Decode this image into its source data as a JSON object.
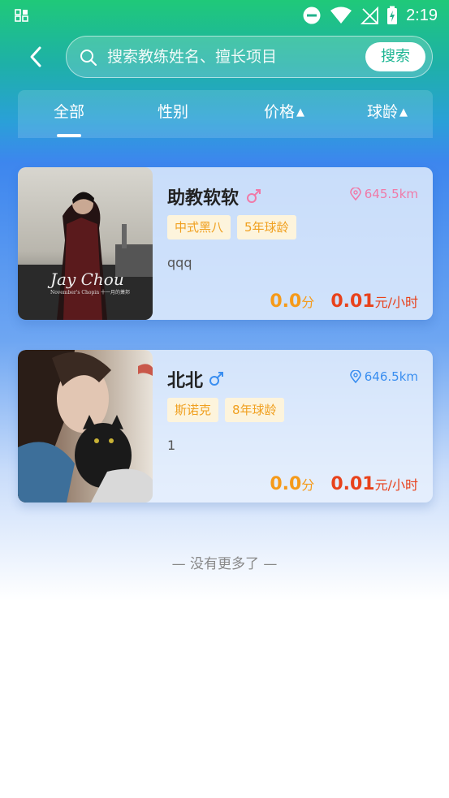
{
  "status_bar": {
    "time": "2:19"
  },
  "search": {
    "placeholder": "搜索教练姓名、擅长项目",
    "value": "",
    "button_label": "搜索"
  },
  "tabs": [
    {
      "label": "全部",
      "active": true
    },
    {
      "label": "性别",
      "active": false
    },
    {
      "label": "价格",
      "caret": "▲"
    },
    {
      "label": "球龄",
      "caret": "▲"
    }
  ],
  "coaches": [
    {
      "name": "助教软软",
      "gender": "female",
      "gender_color": "#f07aa8",
      "distance": "645.5km",
      "distance_color": "#f07aa8",
      "tags": [
        "中式黑八",
        "5年球龄"
      ],
      "description": "qqq",
      "score": "0.0",
      "score_unit": "分",
      "price": "0.01",
      "price_unit": "元/小时",
      "photo_text": "Jay Chou",
      "photo_subtext": "November's Chopin 十一月的萧邦"
    },
    {
      "name": "北北",
      "gender": "male",
      "gender_color": "#3a8ef0",
      "distance": "646.5km",
      "distance_color": "#3a8ef0",
      "tags": [
        "斯诺克",
        "8年球龄"
      ],
      "description": "1",
      "score": "0.0",
      "score_unit": "分",
      "price": "0.01",
      "price_unit": "元/小时"
    }
  ],
  "footer": {
    "no_more_text": "— 没有更多了 —"
  },
  "colors": {
    "accent": "#1db693",
    "score": "#f59a1a",
    "price": "#e8421c",
    "tag_bg": "#fdf4dc",
    "tag_text": "#f0a020"
  }
}
